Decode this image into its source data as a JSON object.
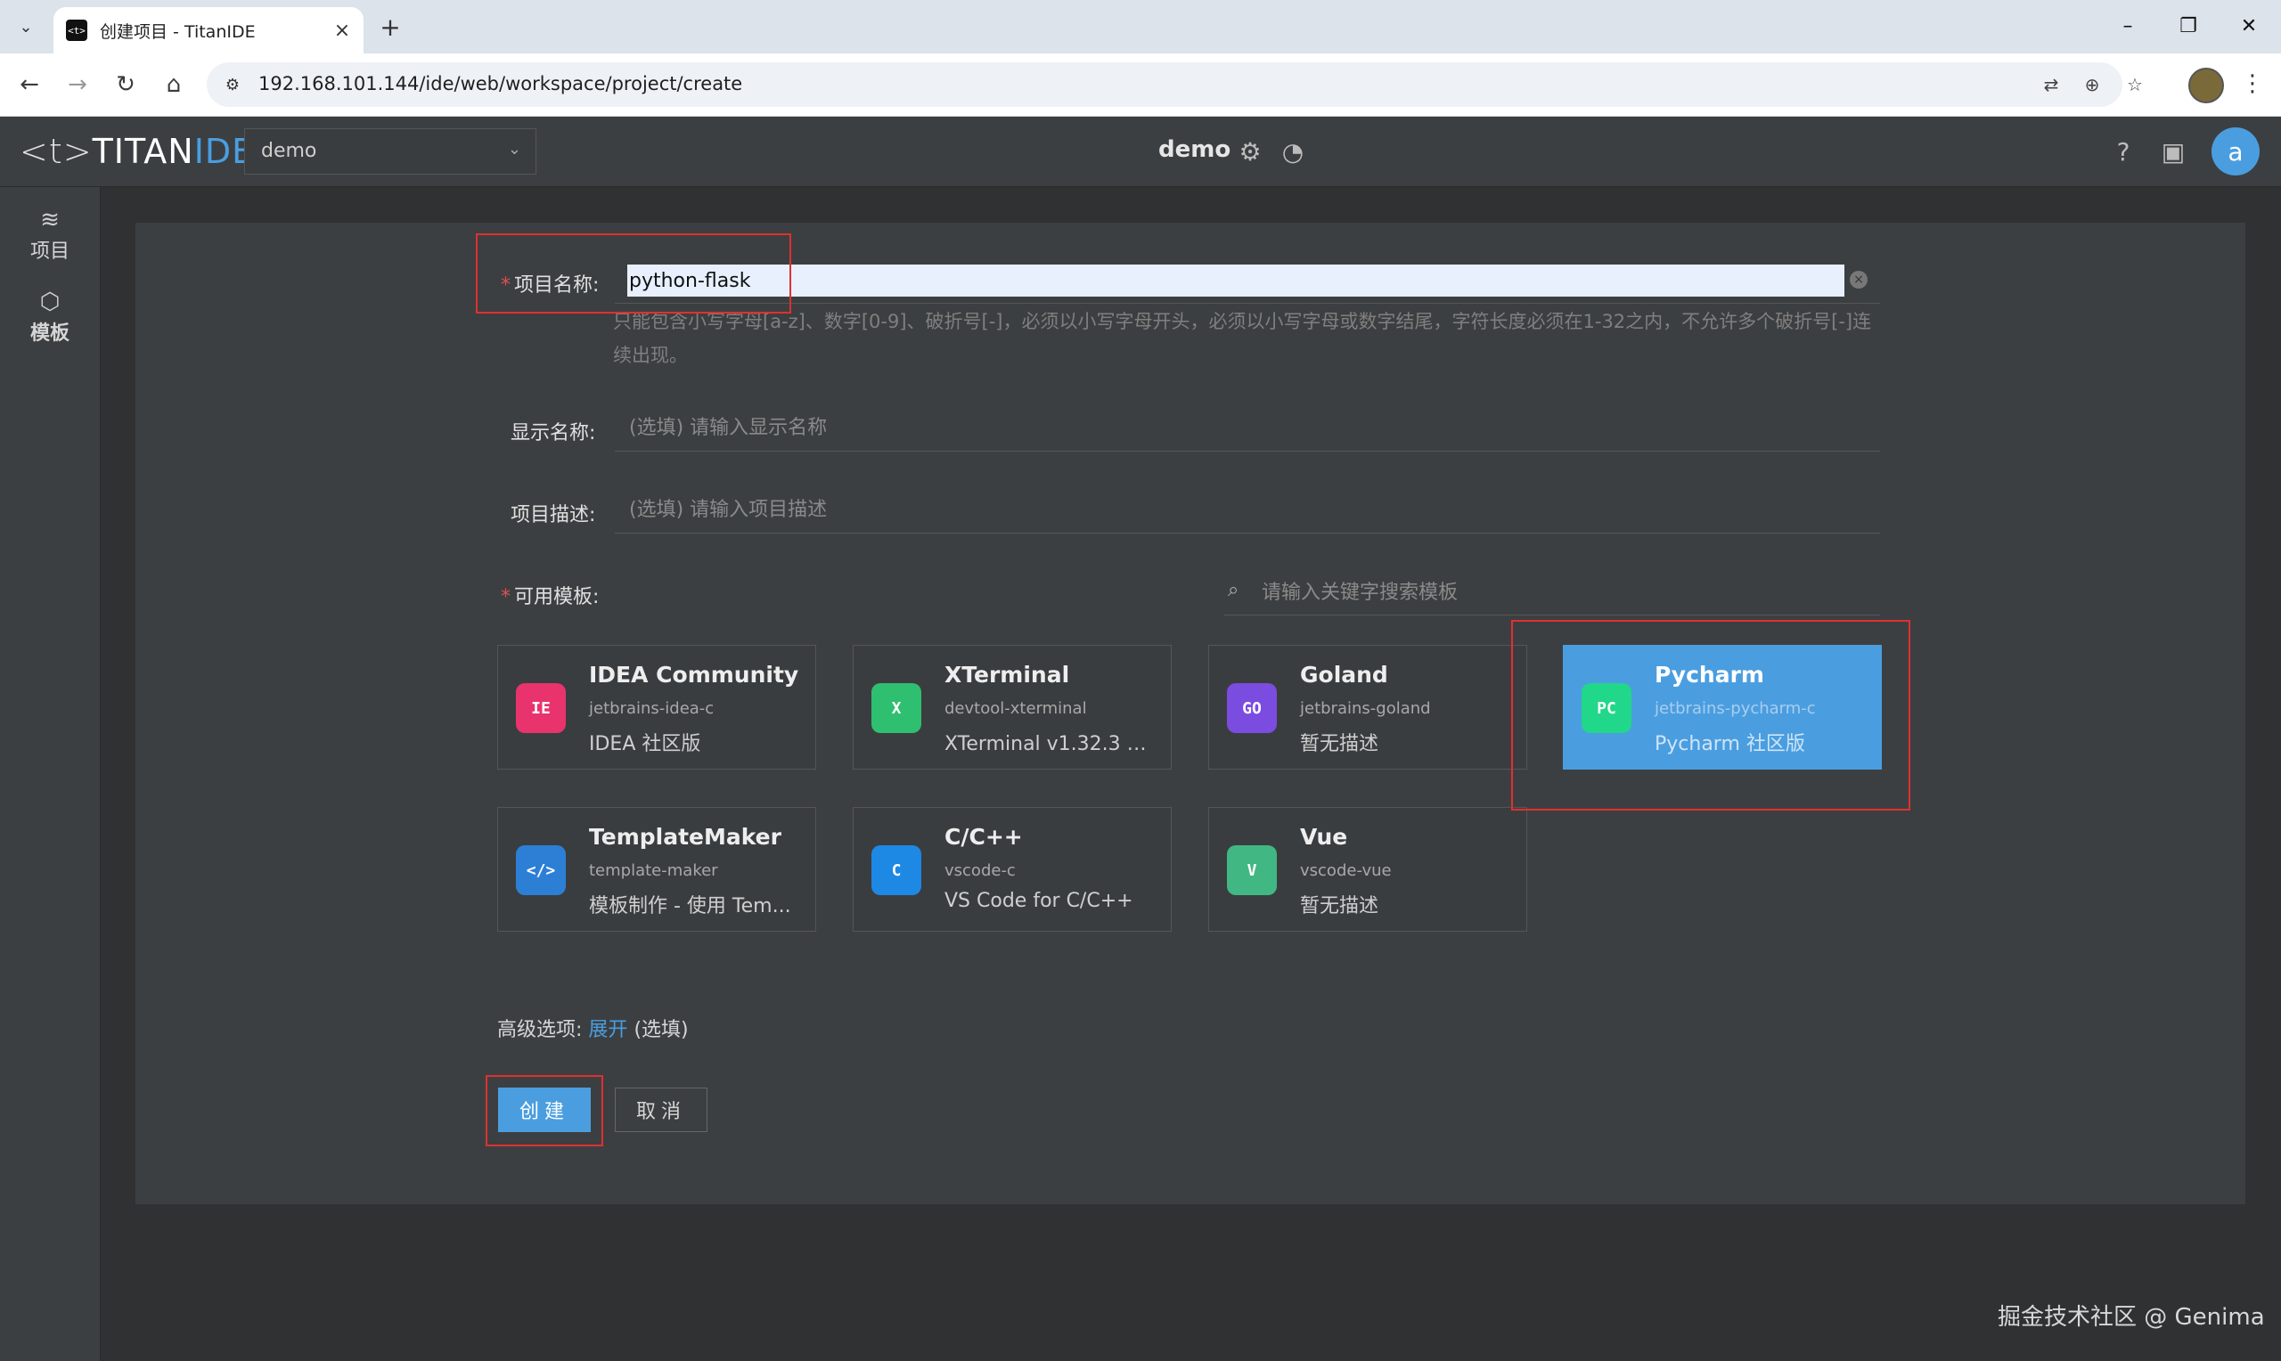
{
  "browser": {
    "tab_title": "创建项目 - TitanIDE",
    "tab_favicon": "<t>",
    "url": "192.168.101.144/ide/web/workspace/project/create"
  },
  "app": {
    "logo": {
      "left": "<t>",
      "titan": "TITAN",
      "ide": "IDE"
    },
    "workspace_selected": "demo",
    "header_title": "demo",
    "avatar_letter": "a",
    "accent_color": "#4a9ee0",
    "highlight_color": "#e03030"
  },
  "sidebar": {
    "items": [
      {
        "label": "项目",
        "icon": "layers-icon"
      },
      {
        "label": "模板",
        "icon": "cube-icon"
      }
    ]
  },
  "form": {
    "name_label": "项目名称:",
    "name_value": "python-flask",
    "name_hint": "只能包含小写字母[a-z]、数字[0-9]、破折号[-]，必须以小写字母开头，必须以小写字母或数字结尾，字符长度必须在1-32之内，不允许多个破折号[-]连续出现。",
    "display_label": "显示名称:",
    "display_placeholder": "(选填) 请输入显示名称",
    "desc_label": "项目描述:",
    "desc_placeholder": "(选填) 请输入项目描述",
    "templates_label": "可用模板:",
    "search_placeholder": "请输入关键字搜索模板"
  },
  "templates": [
    {
      "title": "IDEA Community",
      "id": "jetbrains-idea-c",
      "desc": "IDEA 社区版",
      "icon": "idea-icon",
      "badge": "IE",
      "color": "#e8336d",
      "selected": false
    },
    {
      "title": "XTerminal",
      "id": "devtool-xterminal",
      "desc": "XTerminal v1.32.3 强...",
      "icon": "xterminal-icon",
      "badge": "X",
      "color": "#2fbf71",
      "selected": false
    },
    {
      "title": "Goland",
      "id": "jetbrains-goland",
      "desc": "暂无描述",
      "icon": "goland-icon",
      "badge": "GO",
      "color": "#7b4ce0",
      "selected": false
    },
    {
      "title": "Pycharm",
      "id": "jetbrains-pycharm-c",
      "desc": "Pycharm 社区版",
      "icon": "pycharm-icon",
      "badge": "PC",
      "color": "#21d789",
      "selected": true
    },
    {
      "title": "TemplateMaker",
      "id": "template-maker",
      "desc": "模板制作 - 使用 Tem...",
      "icon": "template-maker-icon",
      "badge": "</>",
      "color": "#2d7fd6",
      "selected": false
    },
    {
      "title": "C/C++",
      "id": "vscode-c",
      "desc": "VS Code for C/C++",
      "icon": "vscode-c-icon",
      "badge": "C",
      "color": "#1e88e5",
      "selected": false
    },
    {
      "title": "Vue",
      "id": "vscode-vue",
      "desc": "暂无描述",
      "icon": "vscode-vue-icon",
      "badge": "V",
      "color": "#41b883",
      "selected": false
    }
  ],
  "advanced": {
    "label": "高级选项:",
    "link": "展开",
    "suffix": "(选填)"
  },
  "buttons": {
    "create": "创建",
    "cancel": "取消"
  },
  "watermark": "掘金技术社区 @ Genima"
}
